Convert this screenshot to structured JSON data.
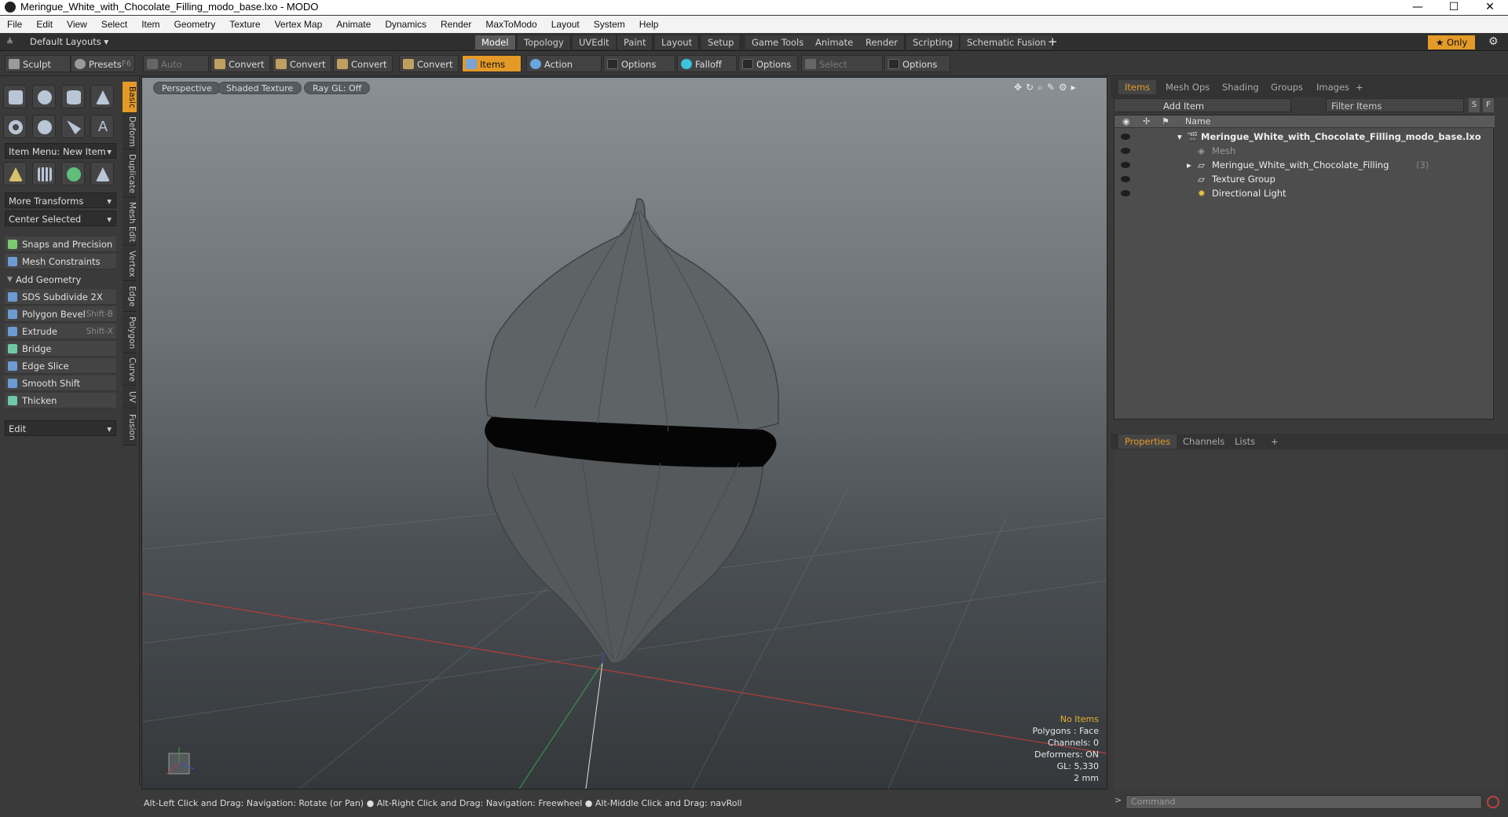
{
  "window": {
    "title": "Meringue_White_with_Chocolate_Filling_modo_base.lxo - MODO",
    "minimize": "—",
    "maximize": "☐",
    "close": "✕"
  },
  "menu": [
    "File",
    "Edit",
    "View",
    "Select",
    "Item",
    "Geometry",
    "Texture",
    "Vertex Map",
    "Animate",
    "Dynamics",
    "Render",
    "MaxToModo",
    "Layout",
    "System",
    "Help"
  ],
  "layouts": {
    "label": "Default Layouts ▾",
    "tabs": [
      "Model",
      "Topology",
      "UVEdit",
      "Paint",
      "Layout",
      "Setup",
      "Game Tools",
      "Animate",
      "Render",
      "Scripting",
      "Schematic Fusion"
    ],
    "add": "+",
    "only": "★  Only",
    "gear": "⚙"
  },
  "toolbar": {
    "sculpt": "Sculpt",
    "presets": "Presets",
    "presets_key": "F6",
    "auto_select": "Auto Select",
    "convert1": "Convert",
    "convert2": "Convert",
    "convert3": "Convert",
    "convert4": "Convert",
    "items": "Items",
    "action_center": "Action Center",
    "options1": "Options",
    "falloff": "Falloff",
    "options2": "Options",
    "select_through": "Select Through",
    "options3": "Options"
  },
  "leftpanel": {
    "vtabs": [
      "Basic",
      "Deform",
      "Duplicate",
      "Mesh Edit",
      "Vertex",
      "Edge",
      "Polygon",
      "Curve",
      "UV",
      "Fusion"
    ],
    "item_menu": "Item Menu: New Item",
    "more_transforms": "More Transforms",
    "center_selected": "Center Selected",
    "snaps": "Snaps and Precision",
    "mesh_constraints": "Mesh Constraints",
    "add_geometry": "Add Geometry",
    "tools": [
      {
        "label": "SDS Subdivide 2X",
        "shortcut": ""
      },
      {
        "label": "Polygon Bevel",
        "shortcut": "Shift-B"
      },
      {
        "label": "Extrude",
        "shortcut": "Shift-X"
      },
      {
        "label": "Bridge",
        "shortcut": ""
      },
      {
        "label": "Edge Slice",
        "shortcut": ""
      },
      {
        "label": "Smooth Shift",
        "shortcut": ""
      },
      {
        "label": "Thicken",
        "shortcut": ""
      }
    ],
    "edit": "Edit"
  },
  "viewport": {
    "perspective": "Perspective",
    "shaded": "Shaded Texture",
    "raygl": "Ray GL: Off",
    "info": {
      "no_items": "No Items",
      "polygons": "Polygons : Face",
      "channels": "Channels: 0",
      "deformers": "Deformers: ON",
      "gl": "GL: 5,330",
      "scale": "2 mm"
    }
  },
  "status": "Alt-Left Click and Drag: Navigation: Rotate (or Pan) ● Alt-Right Click and Drag: Navigation: Freewheel ● Alt-Middle Click and Drag: navRoll",
  "rightpanel": {
    "tabs": [
      "Items",
      "Mesh Ops",
      "Shading",
      "Groups",
      "Images",
      "+"
    ],
    "add_item": "Add Item",
    "filter": "Filter Items",
    "s": "S",
    "f": "F",
    "col_name": "Name",
    "rows": [
      {
        "label": "Meringue_White_with_Chocolate_Filling_modo_base.lxo",
        "suffix": ""
      },
      {
        "label": "Mesh",
        "suffix": ""
      },
      {
        "label": "Meringue_White_with_Chocolate_Filling",
        "suffix": "(3)"
      },
      {
        "label": "Texture Group",
        "suffix": ""
      },
      {
        "label": "Directional Light",
        "suffix": ""
      }
    ],
    "props_tabs": [
      "Properties",
      "Channels",
      "Lists",
      "+"
    ],
    "command_placeholder": "Command",
    "prompt": ">"
  }
}
